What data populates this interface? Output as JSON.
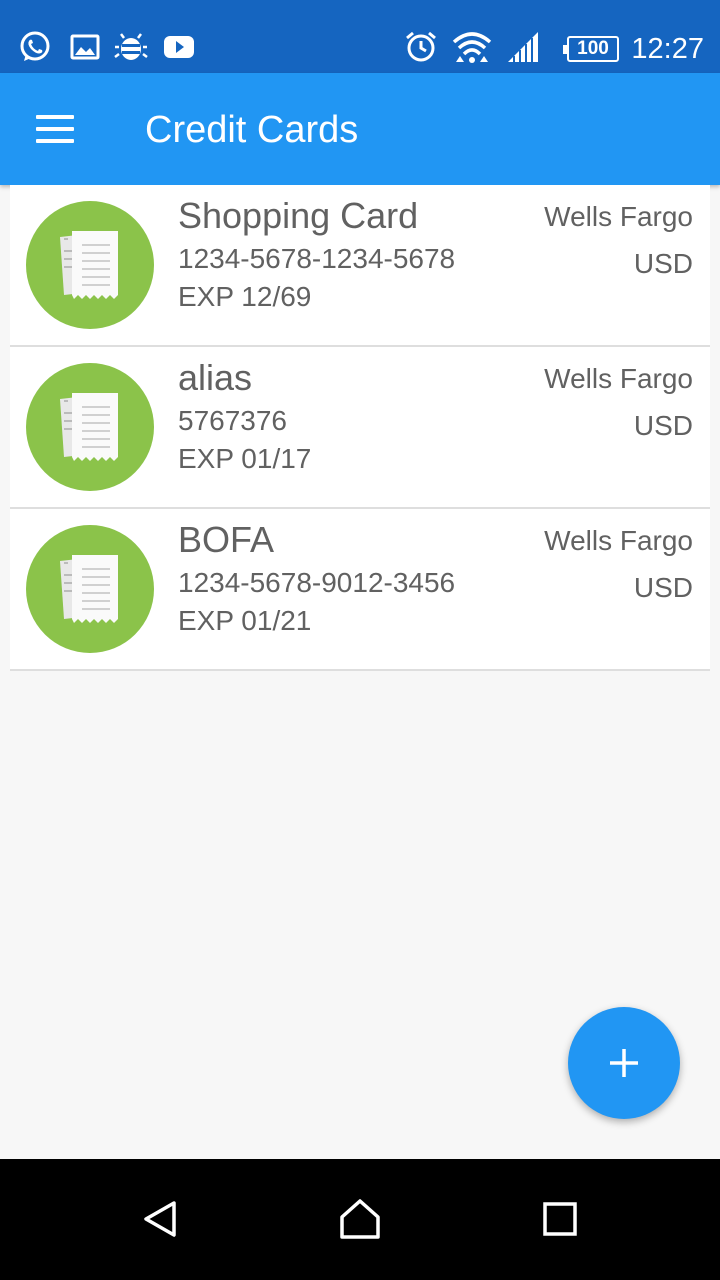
{
  "status_bar": {
    "time": "12:27",
    "battery": "100",
    "icons": [
      "whatsapp-icon",
      "gallery-icon",
      "bug-icon",
      "youtube-icon",
      "alarm-icon",
      "wifi-icon",
      "signal-icon",
      "battery-icon"
    ]
  },
  "app_bar": {
    "title": "Credit Cards",
    "menu_icon": "hamburger-menu-icon"
  },
  "cards": [
    {
      "name": "Shopping Card",
      "number": "1234-5678-1234-5678",
      "exp": "EXP 12/69",
      "bank": "Wells Fargo",
      "currency": "USD"
    },
    {
      "name": "alias",
      "number": "5767376",
      "exp": "EXP 01/17",
      "bank": "Wells Fargo",
      "currency": "USD"
    },
    {
      "name": "BOFA",
      "number": "1234-5678-9012-3456",
      "exp": "EXP 01/21",
      "bank": "Wells Fargo",
      "currency": "USD"
    }
  ],
  "fab": {
    "icon": "plus-icon"
  },
  "nav_bar": {
    "icons": [
      "back-icon",
      "home-icon",
      "recents-icon"
    ]
  },
  "colors": {
    "status_bar": "#1565c0",
    "app_bar": "#2196f3",
    "avatar": "#8bc34a",
    "fab": "#2196f3",
    "text": "#616161"
  }
}
